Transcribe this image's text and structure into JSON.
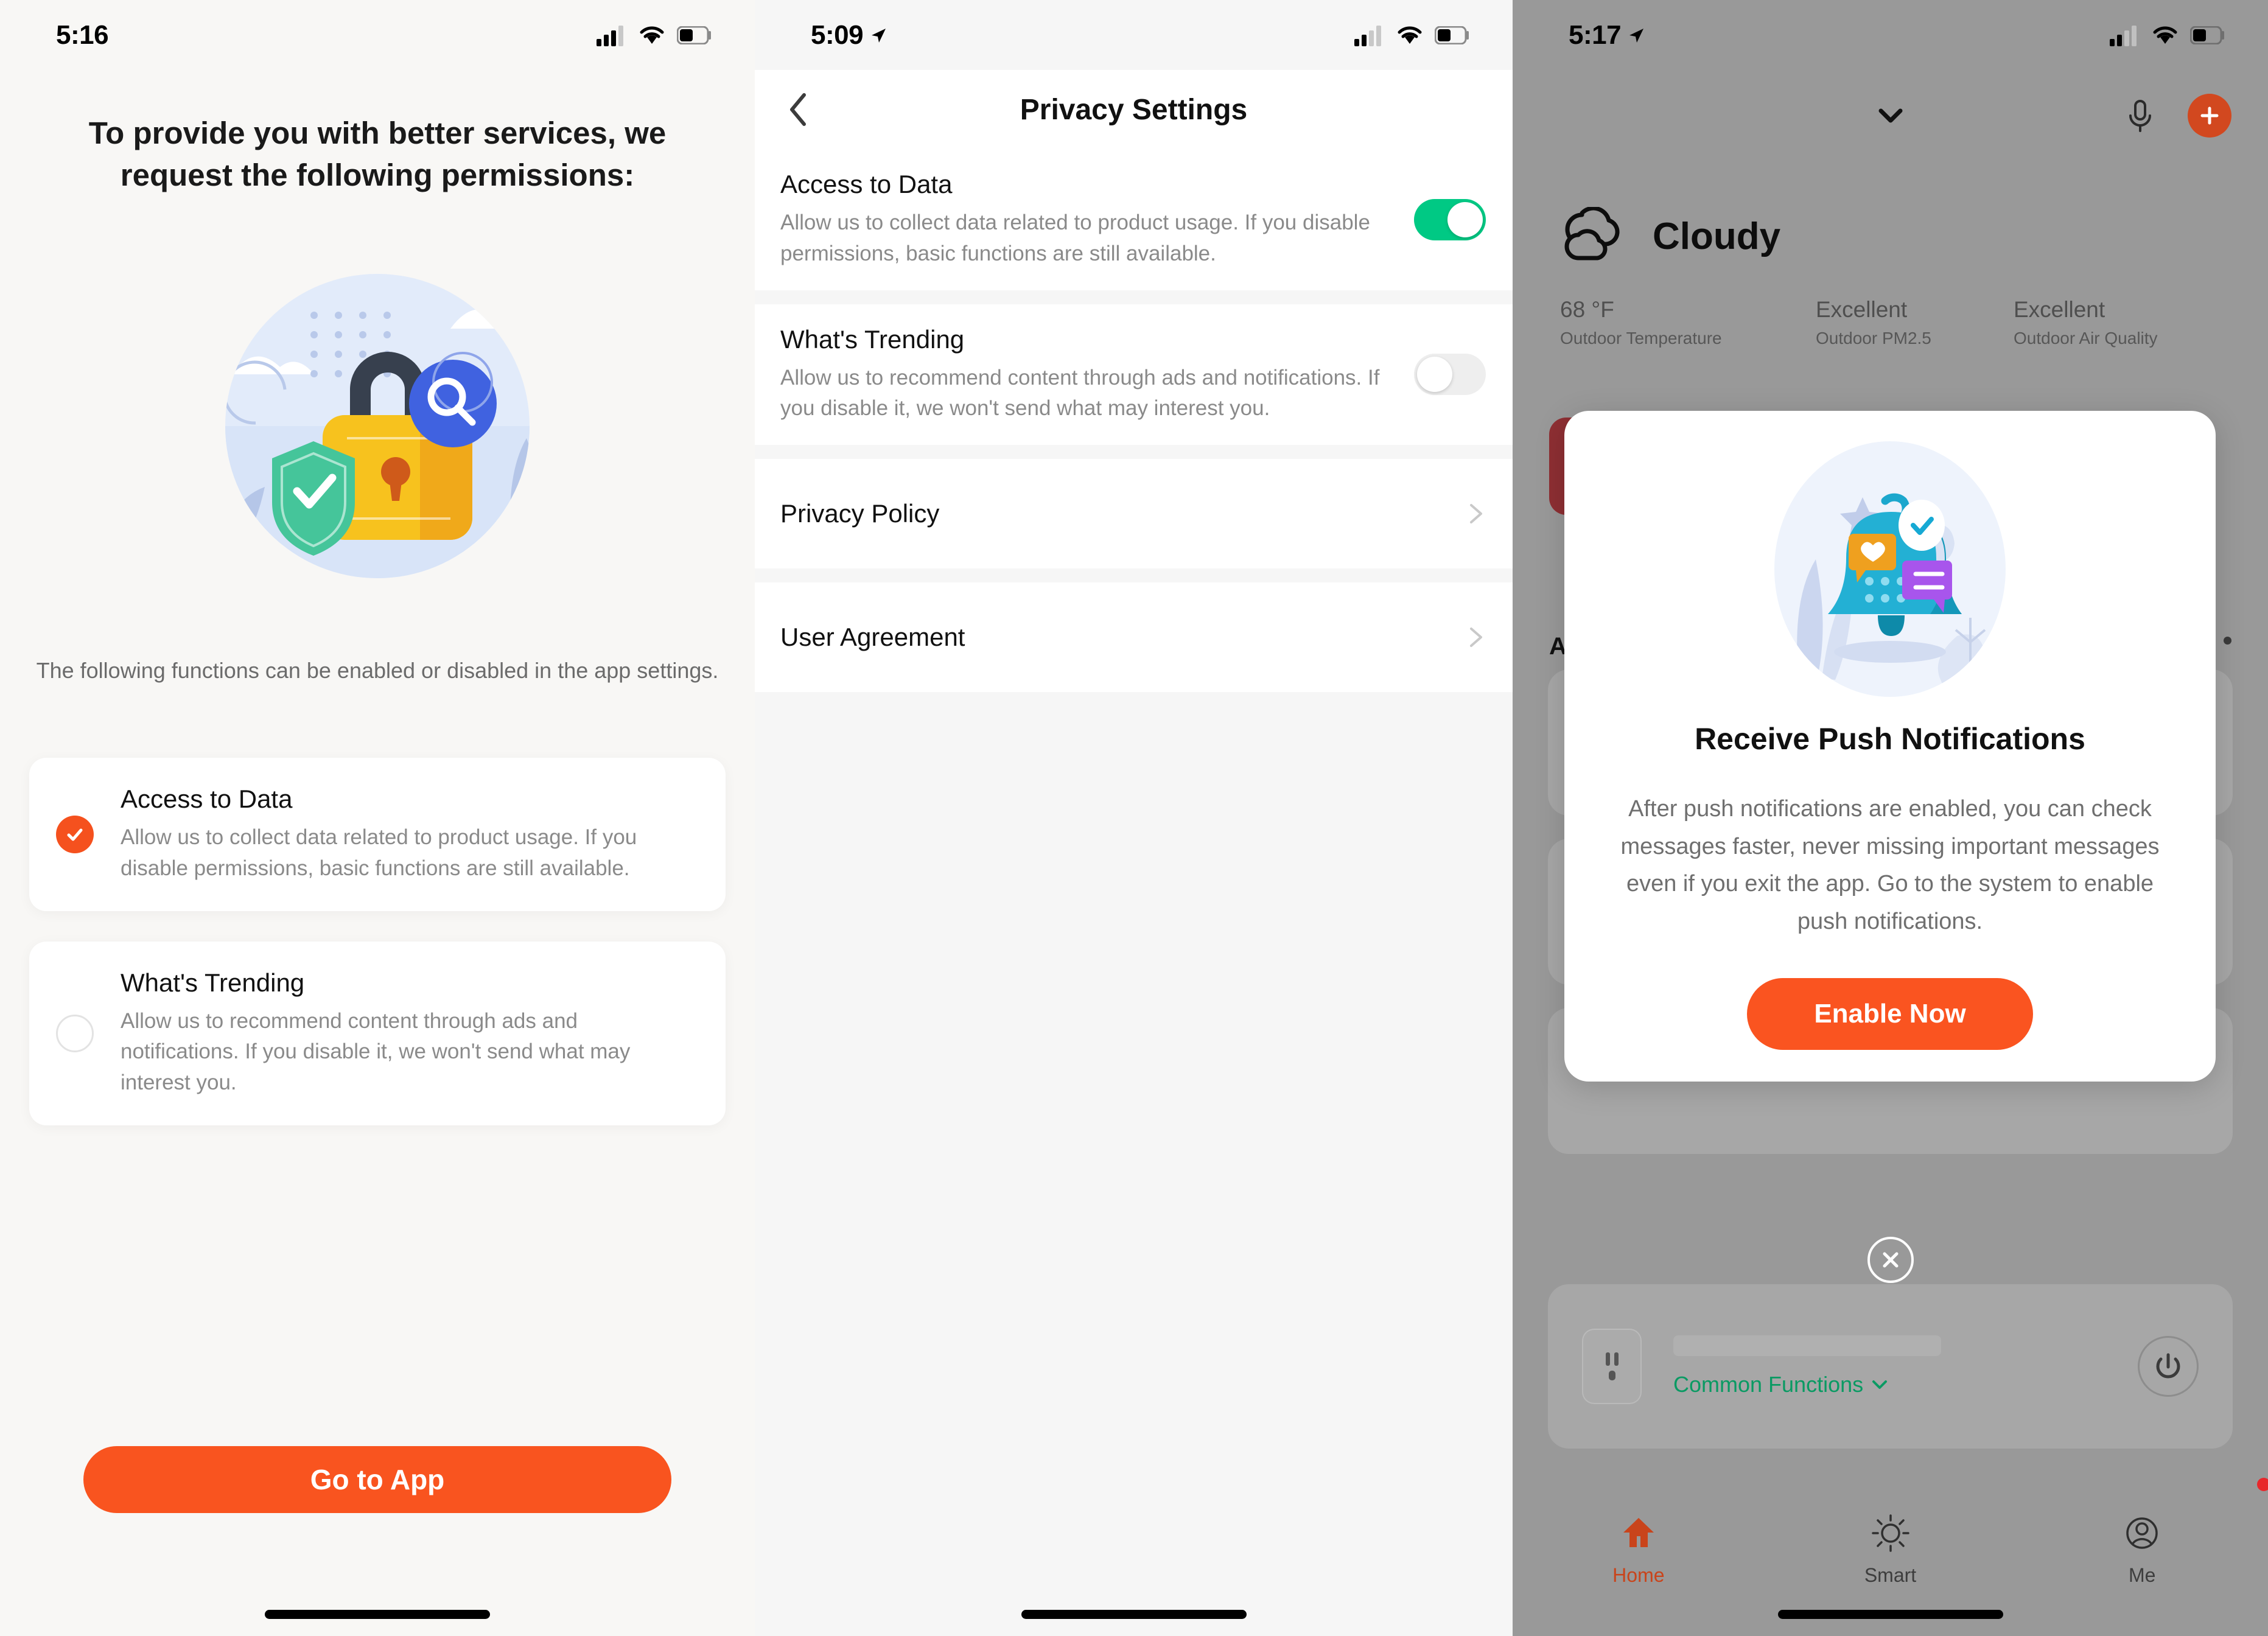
{
  "colors": {
    "accent_orange": "#fa5420",
    "toggle_green": "#00c984",
    "link_green": "#0a9a63",
    "modal_button": "#fa5420",
    "home_tab_active": "#c9441b",
    "badge_red": "#e8272b",
    "red_card": "#8e2f33"
  },
  "panel1": {
    "status": {
      "time": "5:16",
      "location_icon": "",
      "cellular_icon": "signal-bars-icon",
      "wifi_icon": "wifi-icon",
      "battery_icon": "battery-icon"
    },
    "title": "To provide you with better services, we request the following permissions:",
    "illustration_name": "privacy-lock-illustration",
    "subtitle": "The following functions can be enabled or disabled in the app settings.",
    "permissions": [
      {
        "title": "Access to Data",
        "desc": "Allow us to collect data related to product usage. If you disable permissions, basic functions are still available.",
        "checked": true
      },
      {
        "title": "What's Trending",
        "desc": "Allow us to recommend content through ads and notifications. If you disable it, we won't send what may interest you.",
        "checked": false
      }
    ],
    "cta_label": "Go to App"
  },
  "panel2": {
    "status": {
      "time": "5:09",
      "location_icon": "location-arrow-icon",
      "cellular_icon": "signal-bars-icon",
      "wifi_icon": "wifi-icon",
      "battery_icon": "battery-icon"
    },
    "nav_title": "Privacy Settings",
    "back_icon": "chevron-left-icon",
    "toggles": [
      {
        "title": "Access to Data",
        "desc": "Allow us to collect data related to product usage. If you disable permissions, basic functions are still available.",
        "on": true
      },
      {
        "title": "What's Trending",
        "desc": "Allow us to recommend content through ads and notifications. If you disable it, we won't send what may interest you.",
        "on": false
      }
    ],
    "links": [
      {
        "label": "Privacy Policy"
      },
      {
        "label": "User Agreement"
      }
    ]
  },
  "panel3": {
    "status": {
      "time": "5:17",
      "location_icon": "location-arrow-icon",
      "cellular_icon": "signal-bars-icon",
      "wifi_icon": "wifi-icon",
      "battery_icon": "battery-icon"
    },
    "topbar": {
      "chevron_icon": "chevron-down-icon",
      "mic_icon": "microphone-icon",
      "add_icon": "plus-icon"
    },
    "weather": {
      "condition": "Cloudy",
      "icon": "cloud-icon",
      "metrics": [
        {
          "value": "68 °F",
          "label": "Outdoor Temperature"
        },
        {
          "value": "Excellent",
          "label": "Outdoor PM2.5"
        },
        {
          "value": "Excellent",
          "label": "Outdoor Air Quality"
        }
      ]
    },
    "section_label": "All",
    "more_icon": "more-dots-icon",
    "device": {
      "icon": "power-outlet-icon",
      "functions_label": "Common Functions",
      "functions_caret": "chevron-down-icon",
      "power_icon": "power-icon"
    },
    "modal": {
      "illustration_name": "push-notification-bell-illustration",
      "title": "Receive Push Notifications",
      "desc": "After push notifications are enabled, you can check messages faster, never missing important messages even if you exit the app. Go to the system to enable push notifications.",
      "button_label": "Enable Now",
      "close_icon": "close-icon"
    },
    "tabs": [
      {
        "label": "Home",
        "icon": "home-icon",
        "active": true,
        "badge": false
      },
      {
        "label": "Smart",
        "icon": "sun-icon",
        "active": false,
        "badge": false
      },
      {
        "label": "Me",
        "icon": "person-icon",
        "active": false,
        "badge": true
      }
    ]
  }
}
